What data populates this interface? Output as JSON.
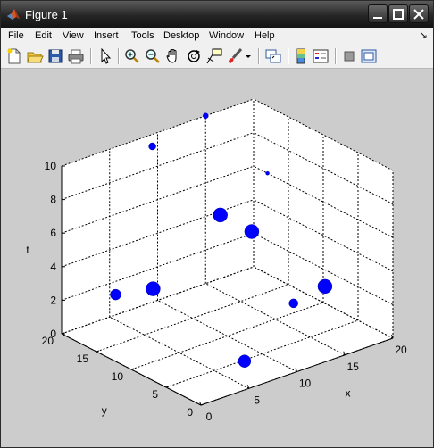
{
  "window": {
    "title": "Figure 1"
  },
  "menu": {
    "items": [
      "File",
      "Edit",
      "View",
      "Insert",
      "Tools",
      "Desktop",
      "Window",
      "Help"
    ],
    "dock_arrow": "↘"
  },
  "toolbar": {
    "buttons": [
      "new-figure",
      "open-file",
      "save-figure",
      "print-figure",
      "edit-plot",
      "zoom-in",
      "zoom-out",
      "pan",
      "rotate-3d",
      "data-cursor",
      "brush",
      "brush-dropdown",
      "link-plot",
      "colorbar",
      "legend",
      "hide-plot-tools",
      "show-plot-tools"
    ]
  },
  "chart_data": {
    "type": "scatter3d",
    "title": "",
    "xlabel": "x",
    "ylabel": "y",
    "zlabel": "t",
    "xlim": [
      0,
      20
    ],
    "ylim": [
      0,
      20
    ],
    "zlim": [
      0,
      10
    ],
    "xticks": [
      "0",
      "5",
      "10",
      "15",
      "20"
    ],
    "yticks": [
      "0",
      "5",
      "10",
      "15",
      "20"
    ],
    "zticks": [
      "0",
      "2",
      "4",
      "6",
      "8",
      "10"
    ],
    "grid": true,
    "marker_color": "#0000ff",
    "points": [
      {
        "x": 2,
        "y": 15,
        "z": 3,
        "size": 6
      },
      {
        "x": 3,
        "y": 11,
        "z": 4,
        "size": 8
      },
      {
        "x": 8,
        "y": 18,
        "z": 10,
        "size": 4
      },
      {
        "x": 15,
        "y": 20,
        "z": 10,
        "size": 3
      },
      {
        "x": 10,
        "y": 11,
        "z": 7,
        "size": 8
      },
      {
        "x": 14,
        "y": 12,
        "z": 5,
        "size": 8
      },
      {
        "x": 6,
        "y": 2,
        "z": 1,
        "size": 7
      },
      {
        "x": 14,
        "y": 6,
        "z": 2,
        "size": 5
      },
      {
        "x": 18,
        "y": 7,
        "z": 2,
        "size": 8
      },
      {
        "x": 20,
        "y": 18,
        "z": 6,
        "size": 2
      }
    ]
  }
}
